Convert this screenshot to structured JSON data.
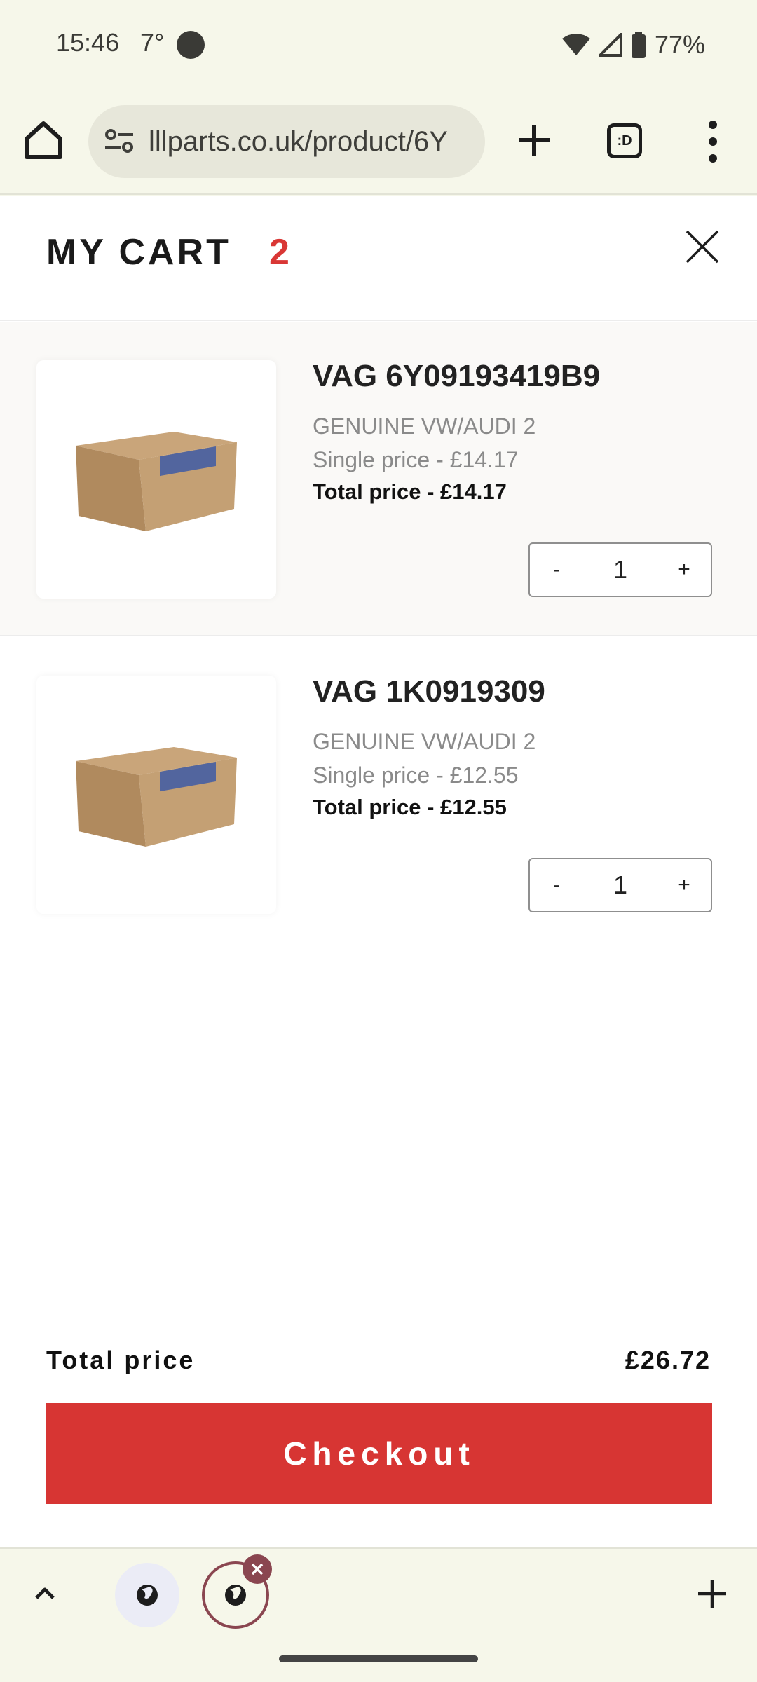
{
  "status_bar": {
    "time": "15:46",
    "temperature": "7°",
    "battery": "77%"
  },
  "browser": {
    "url": "lllparts.co.uk/product/6Y",
    "tab_count_label": ":D"
  },
  "cart": {
    "title": "MY CART",
    "count": "2",
    "items": [
      {
        "name": "VAG 6Y09193419B9",
        "brand": "GENUINE VW/AUDI 2",
        "single_price": "Single price - £14.17",
        "total_price": "Total price - £14.17",
        "qty_minus": "-",
        "quantity": "1",
        "qty_plus": "+",
        "thumbnail_icon": "parcel-box-image"
      },
      {
        "name": "VAG 1K0919309",
        "brand": "GENUINE VW/AUDI 2",
        "single_price": "Single price - £12.55",
        "total_price": "Total price - £12.55",
        "qty_minus": "-",
        "quantity": "1",
        "qty_plus": "+",
        "thumbnail_icon": "parcel-box-image"
      }
    ],
    "total_label": "Total price",
    "total_value": "£26.72",
    "checkout_label": "Checkout"
  },
  "colors": {
    "accent": "#d73533",
    "browser_bg": "#f6f7ea",
    "tab_active": "#8a4650"
  }
}
